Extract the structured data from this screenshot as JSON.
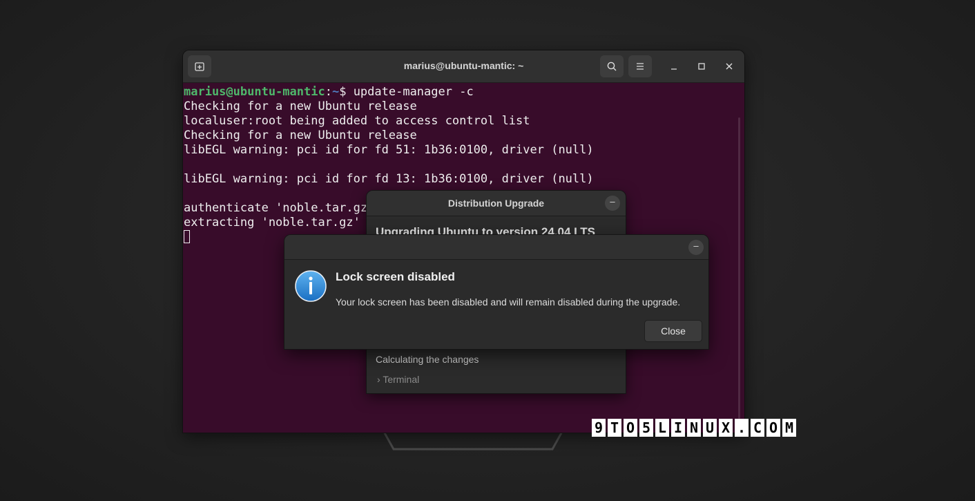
{
  "terminal": {
    "title": "marius@ubuntu-mantic: ~",
    "prompt_user": "marius@ubuntu-mantic",
    "prompt_sep": ":",
    "prompt_path": "~",
    "prompt_symbol": "$ ",
    "command": "update-manager -c",
    "output": [
      "Checking for a new Ubuntu release",
      "localuser:root being added to access control list",
      "Checking for a new Ubuntu release",
      "libEGL warning: pci id for fd 51: 1b36:0100, driver (null)",
      "",
      "libEGL warning: pci id for fd 13: 1b36:0100, driver (null)",
      "",
      "authenticate 'noble.tar.gz'",
      "extracting 'noble.tar.gz'"
    ],
    "colors": {
      "background": "#380c2a",
      "user": "#4fb86b",
      "path": "#4f7dbf"
    }
  },
  "upgrade_window": {
    "title": "Distribution Upgrade",
    "heading": "Upgrading Ubuntu to version 24.04 LTS",
    "status": "Calculating the changes",
    "terminal_expander": "Terminal",
    "progress_color": "#c7541e"
  },
  "dialog": {
    "title": "Lock screen disabled",
    "message": "Your lock screen has been disabled and will remain disabled during the upgrade.",
    "close_label": "Close",
    "icon": "info-icon"
  },
  "watermark": {
    "text": "9TO5LINUX.COM"
  }
}
